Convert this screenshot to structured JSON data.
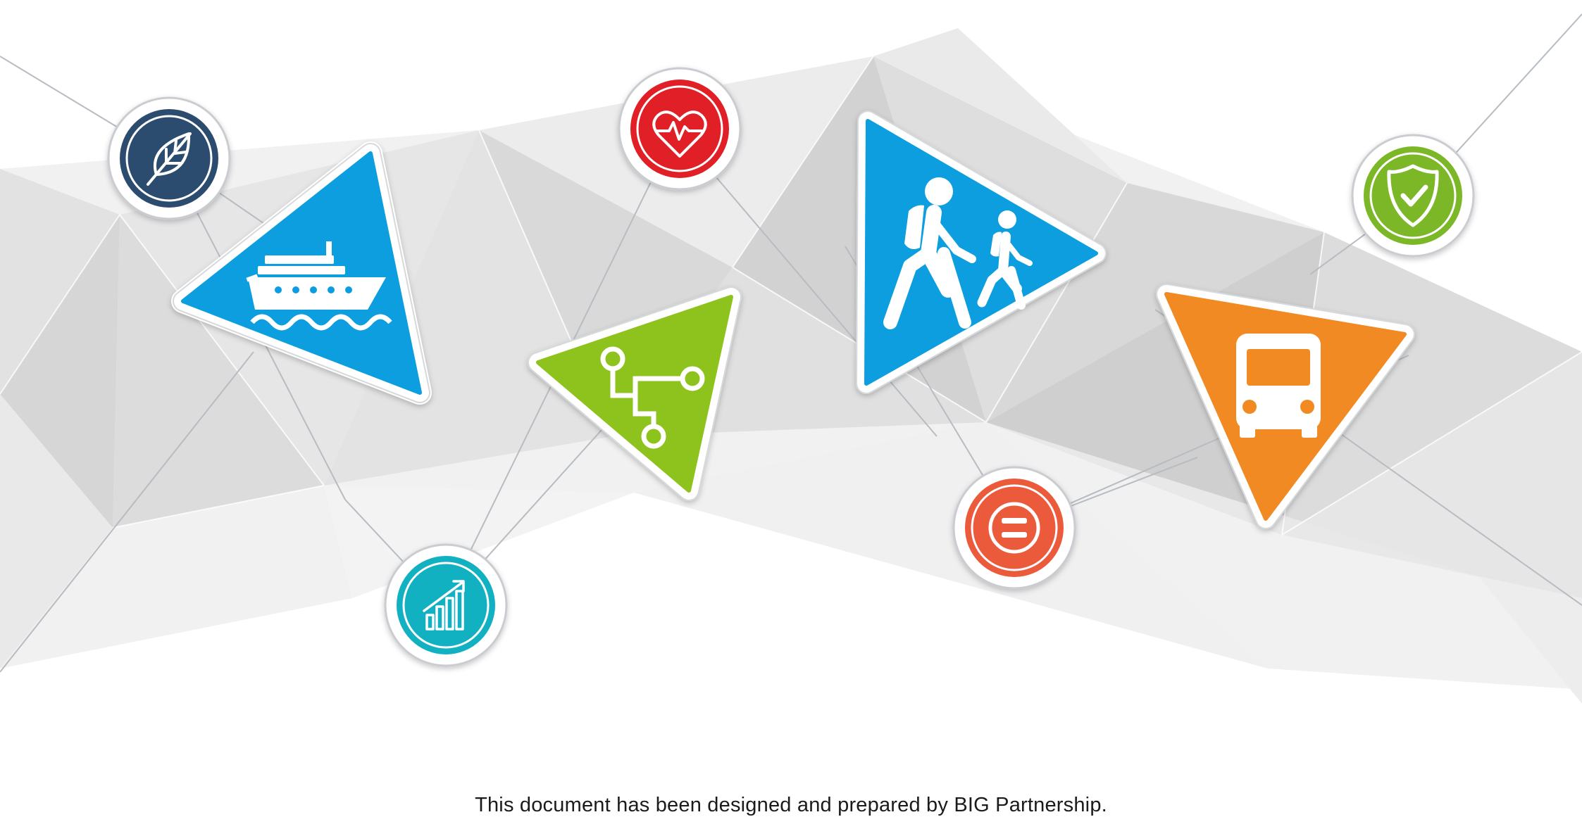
{
  "footer": {
    "text": "This document has been designed and prepared by BIG Partnership."
  },
  "colors": {
    "blue": "#0a9ee0",
    "green": "#8ec21f",
    "orange": "#f18a22",
    "navy": "#2b4c6f",
    "red": "#e11f26",
    "teal": "#12b1c2",
    "coral": "#ec5a3c",
    "lime": "#7bb727"
  },
  "icons": [
    "leaf-icon",
    "cruise-ship-icon",
    "heartbeat-icon",
    "connected-nodes-icon",
    "pedestrians-icon",
    "growth-chart-icon",
    "equals-icon",
    "bus-icon",
    "shield-check-icon"
  ]
}
